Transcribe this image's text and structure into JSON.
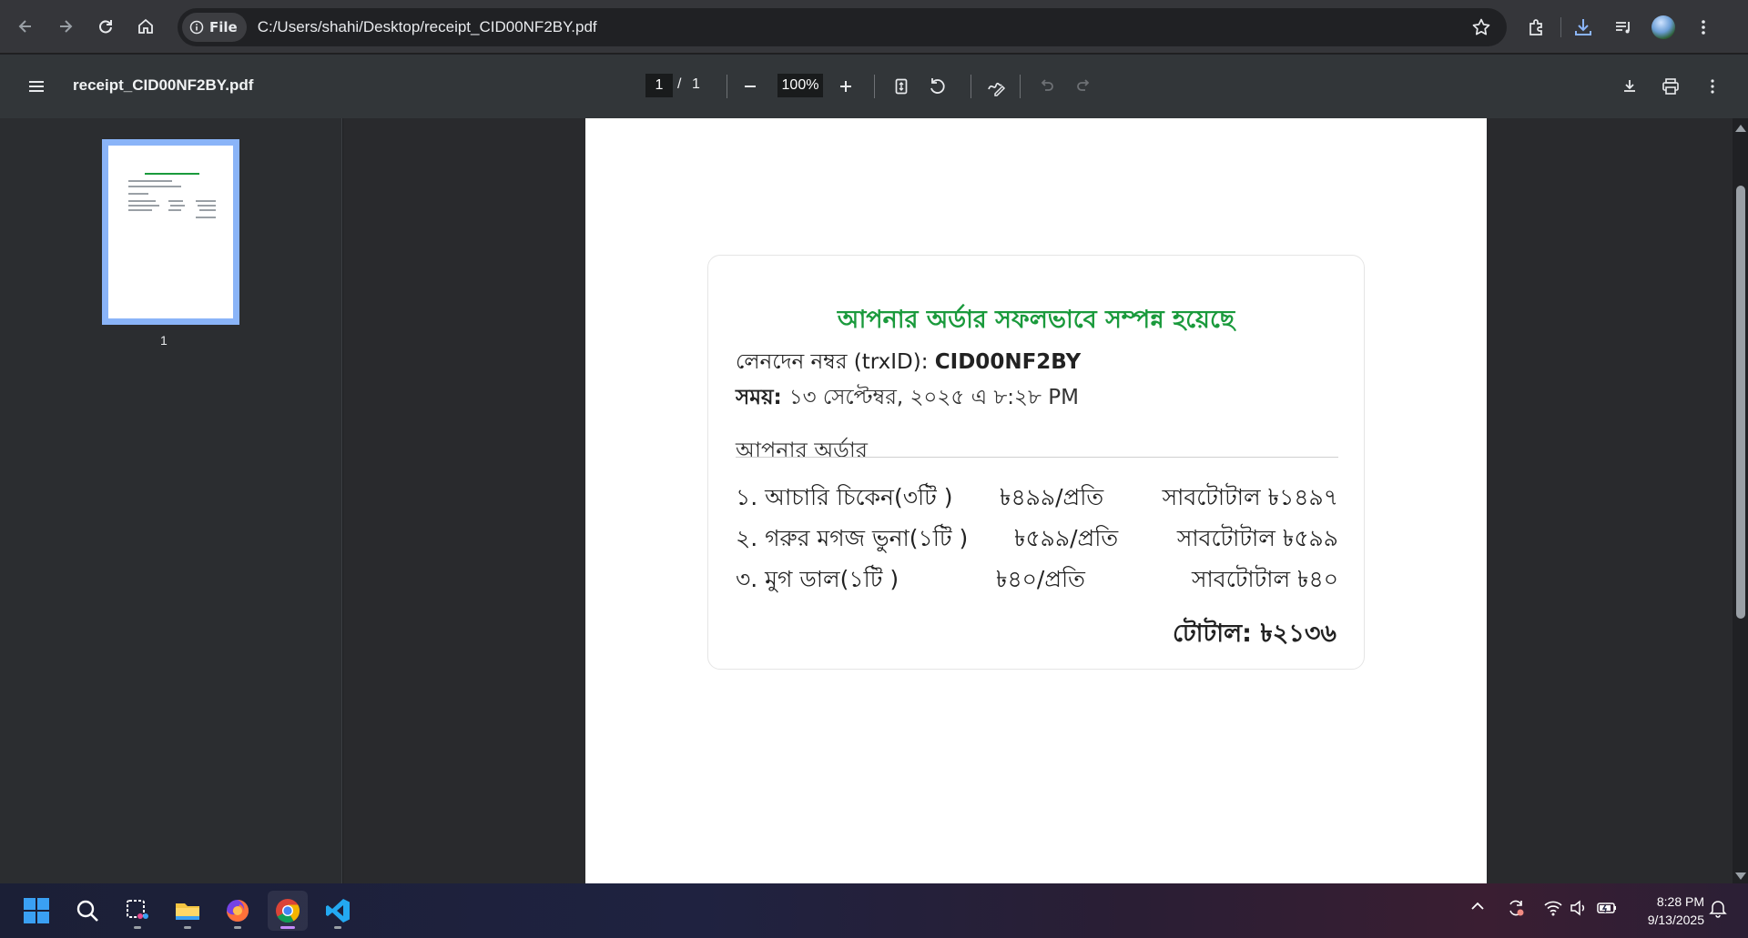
{
  "browser": {
    "site_chip": "File",
    "url": "C:/Users/shahi/Desktop/receipt_CID00NF2BY.pdf"
  },
  "pdf_toolbar": {
    "title": "receipt_CID00NF2BY.pdf",
    "current_page": "1",
    "page_separator": "/",
    "total_pages": "1",
    "zoom": "100%"
  },
  "sidebar": {
    "thumbnail_label": "1"
  },
  "receipt": {
    "title": "আপনার অর্ডার সফলভাবে সম্পন্ন হয়েছে",
    "trx_label": "লেনদেন নম্বর (trxID): ",
    "trx_id": "CID00NF2BY",
    "time_label": "সময়: ",
    "time_value": "১৩ সেপ্টেম্বর, ২০২৫ এ ৮:২৮ PM",
    "order_heading": "আপনার অর্ডার",
    "items": [
      {
        "name": "১. আচারি চিকেন(৩টি )",
        "price": "৳৪৯৯/প্রতি",
        "subtotal": "সাবটোটাল ৳১৪৯৭"
      },
      {
        "name": "২. গরুর মগজ ভুনা(১টি )",
        "price": "৳৫৯৯/প্রতি",
        "subtotal": "সাবটোটাল ৳৫৯৯"
      },
      {
        "name": "৩. মুগ ডাল(১টি )",
        "price": "৳৪০/প্রতি",
        "subtotal": "সাবটোটাল ৳৪০"
      }
    ],
    "total": "টোটাল: ৳২১৩৬",
    "title_color": "#1a9a3c"
  },
  "taskbar": {
    "time": "8:28 PM",
    "date": "9/13/2025"
  }
}
